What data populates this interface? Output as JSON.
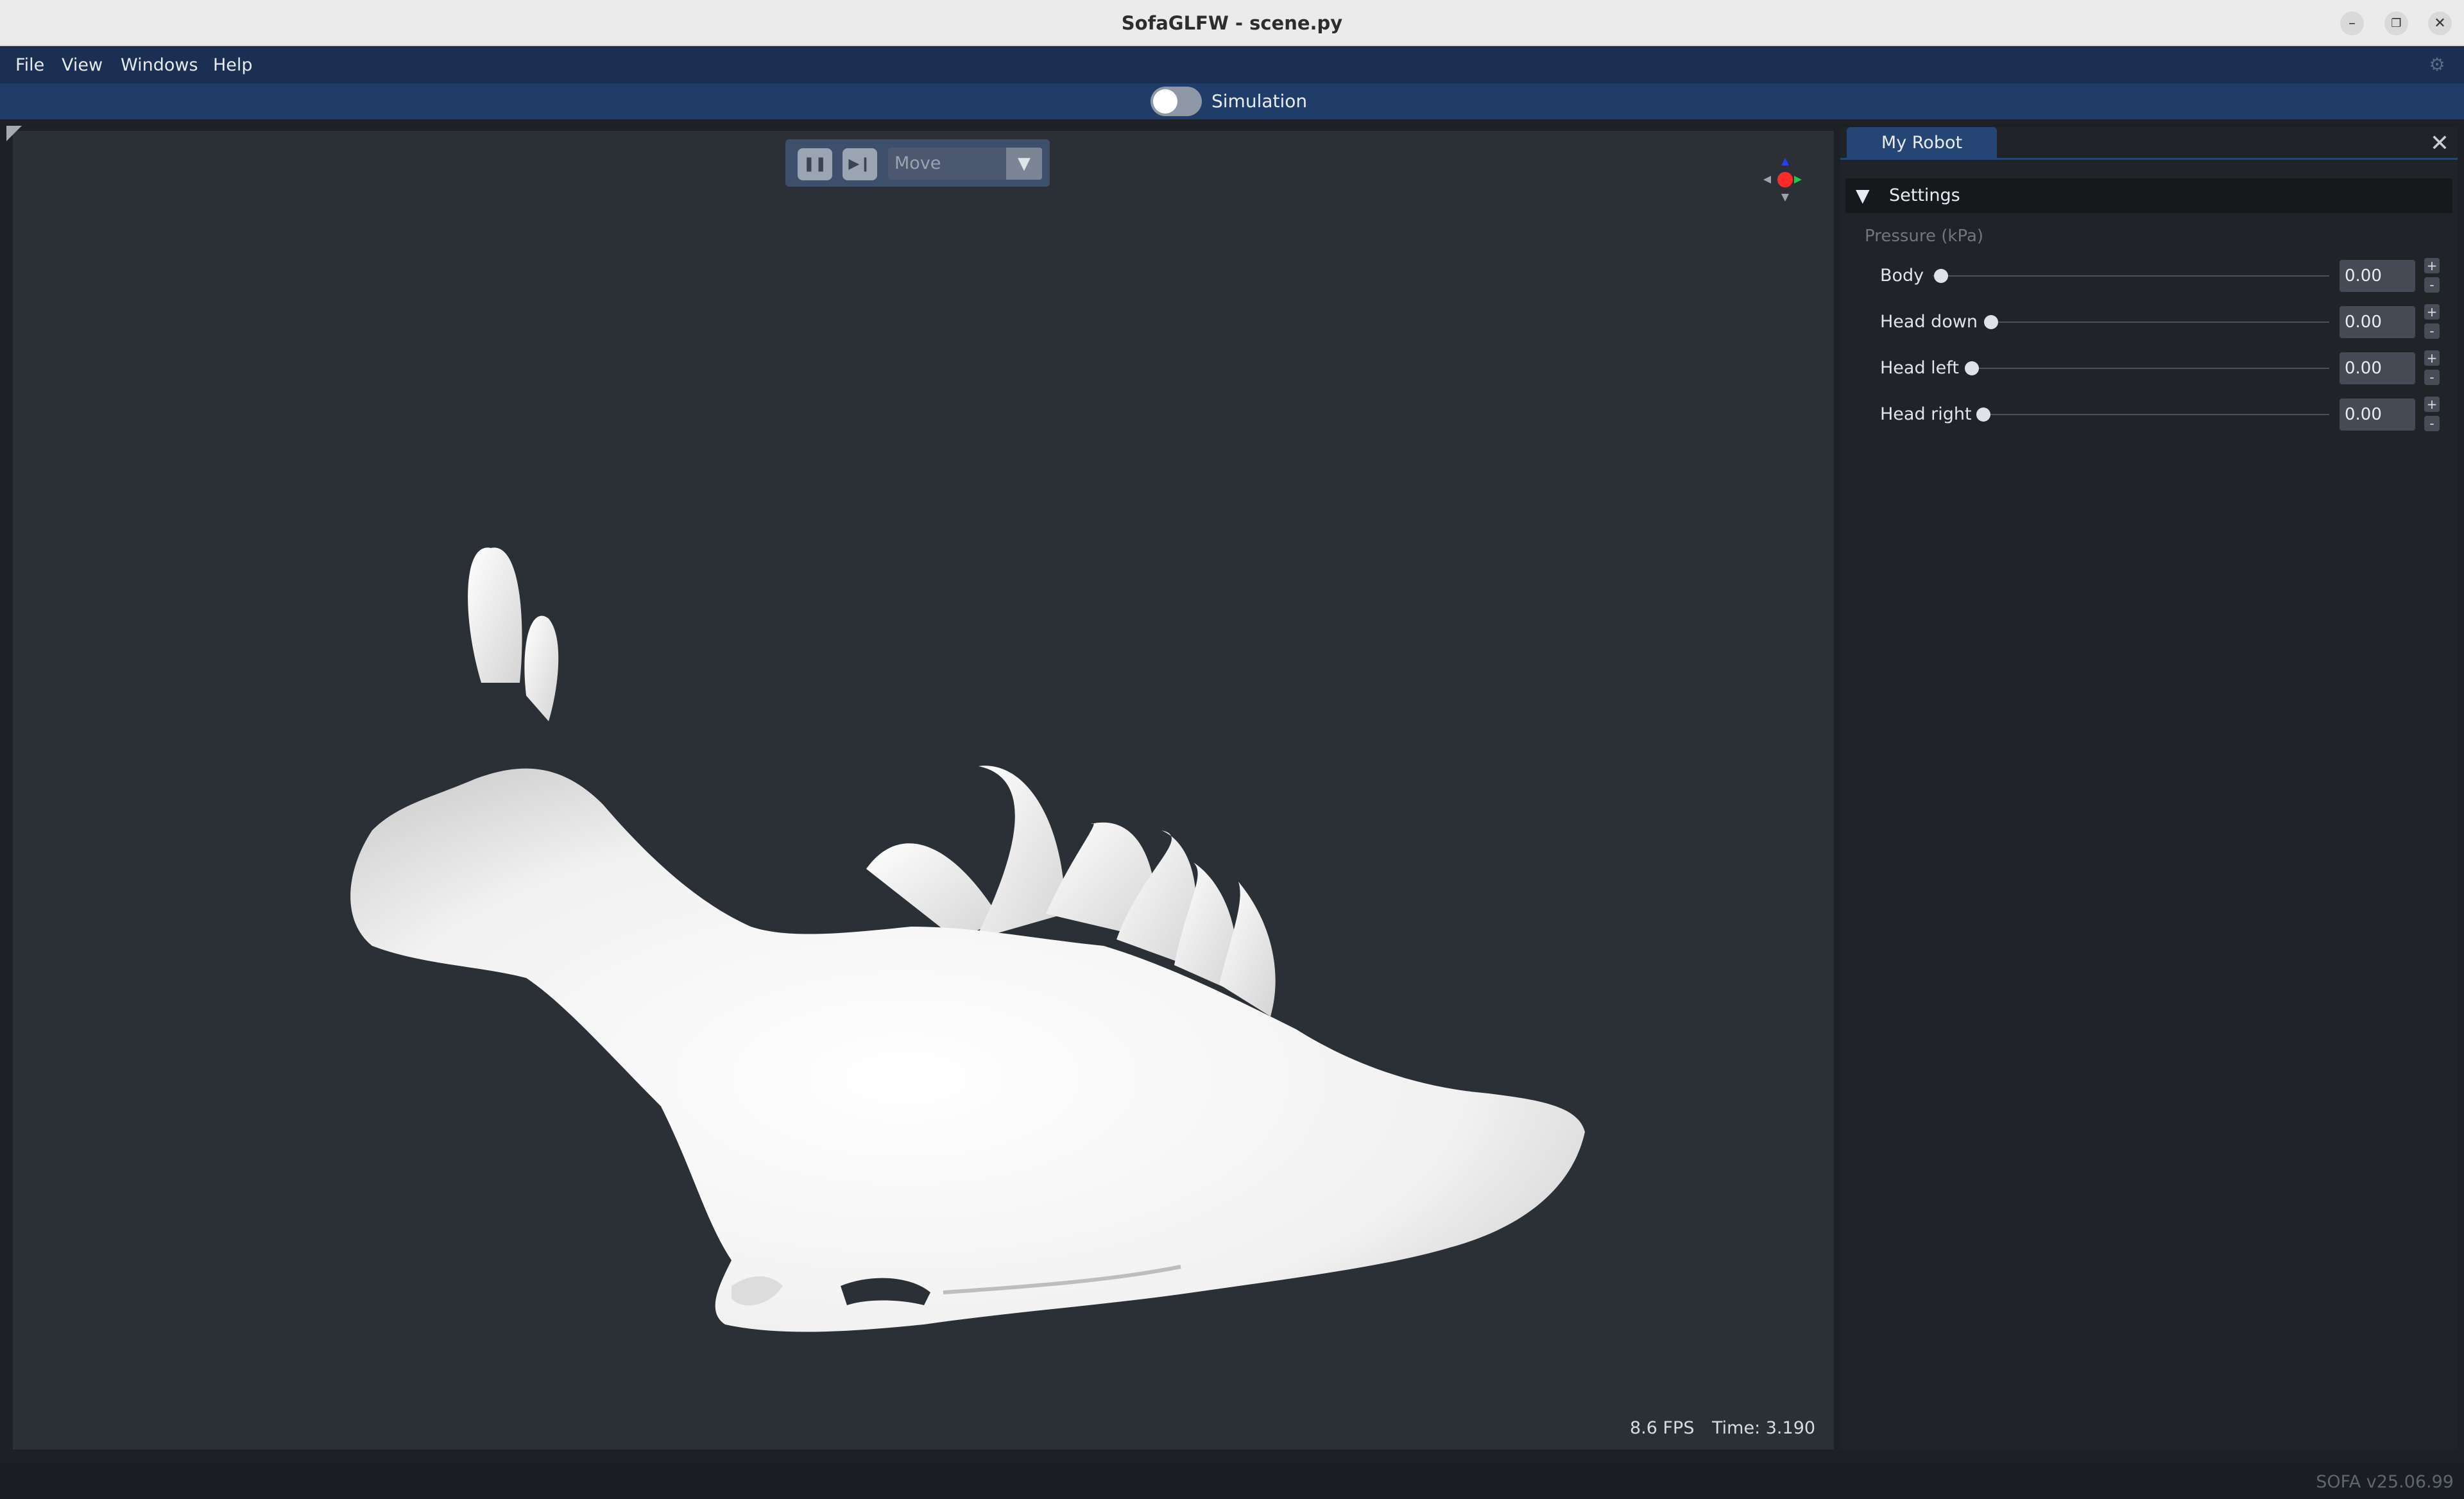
{
  "window": {
    "title": "SofaGLFW - scene.py",
    "controls": [
      "minimize-icon",
      "restore-icon",
      "close-icon"
    ]
  },
  "menu": {
    "items": [
      "File",
      "View",
      "Windows",
      "Help"
    ],
    "settings_icon": "gear-icon"
  },
  "simulation": {
    "toggle_label": "Simulation",
    "running": false
  },
  "viewport": {
    "toolbar": {
      "pause_icon": "pause-icon",
      "step_icon": "step-forward-icon",
      "mode": "Move"
    },
    "orientation_gizmo": "axes-gizmo-icon",
    "fps": "8.6 FPS",
    "time": "Time: 3.190"
  },
  "panel": {
    "tab": "My Robot",
    "section": "Settings",
    "group_label": "Pressure (kPa)",
    "sliders": [
      {
        "label": "Body",
        "value": "0.00",
        "fraction": 0.0
      },
      {
        "label": "Head down",
        "value": "0.00",
        "fraction": 0.0
      },
      {
        "label": "Head left",
        "value": "0.00",
        "fraction": 0.0
      },
      {
        "label": "Head right",
        "value": "0.00",
        "fraction": 0.0
      }
    ]
  },
  "status": {
    "version": "SOFA v25.06.99"
  },
  "colors": {
    "menubar": "#1b2f52",
    "simbar": "#203d6a",
    "viewport_bg": "#2b3036",
    "panel_bg": "#202428",
    "tab_active": "#254574"
  }
}
